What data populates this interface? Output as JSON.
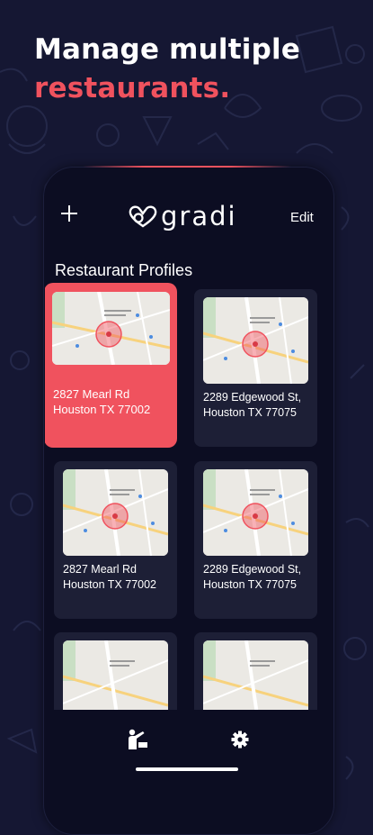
{
  "headline": {
    "line1": "Manage multiple",
    "line2": "restaurants."
  },
  "app": {
    "logo_text": "gradi",
    "add_icon": "plus-icon",
    "edit_label": "Edit",
    "section_title": "Restaurant Profiles"
  },
  "profiles": [
    {
      "address": "2827 Mearl Rd Houston TX 77002",
      "selected": true
    },
    {
      "address": "2289 Edgewood St, Houston TX 77075",
      "selected": false
    },
    {
      "address": "2827 Mearl Rd Houston TX 77002",
      "selected": false
    },
    {
      "address": "2289 Edgewood St, Houston TX 77075",
      "selected": false
    },
    {
      "address": "",
      "selected": false
    },
    {
      "address": "",
      "selected": false
    }
  ],
  "bottom_nav": {
    "left_icon": "person-pointing-icon",
    "right_icon": "gear-icon"
  },
  "colors": {
    "accent": "#f0525e",
    "background": "#151733",
    "card": "#1d1f36",
    "device": "#0c0d22"
  }
}
